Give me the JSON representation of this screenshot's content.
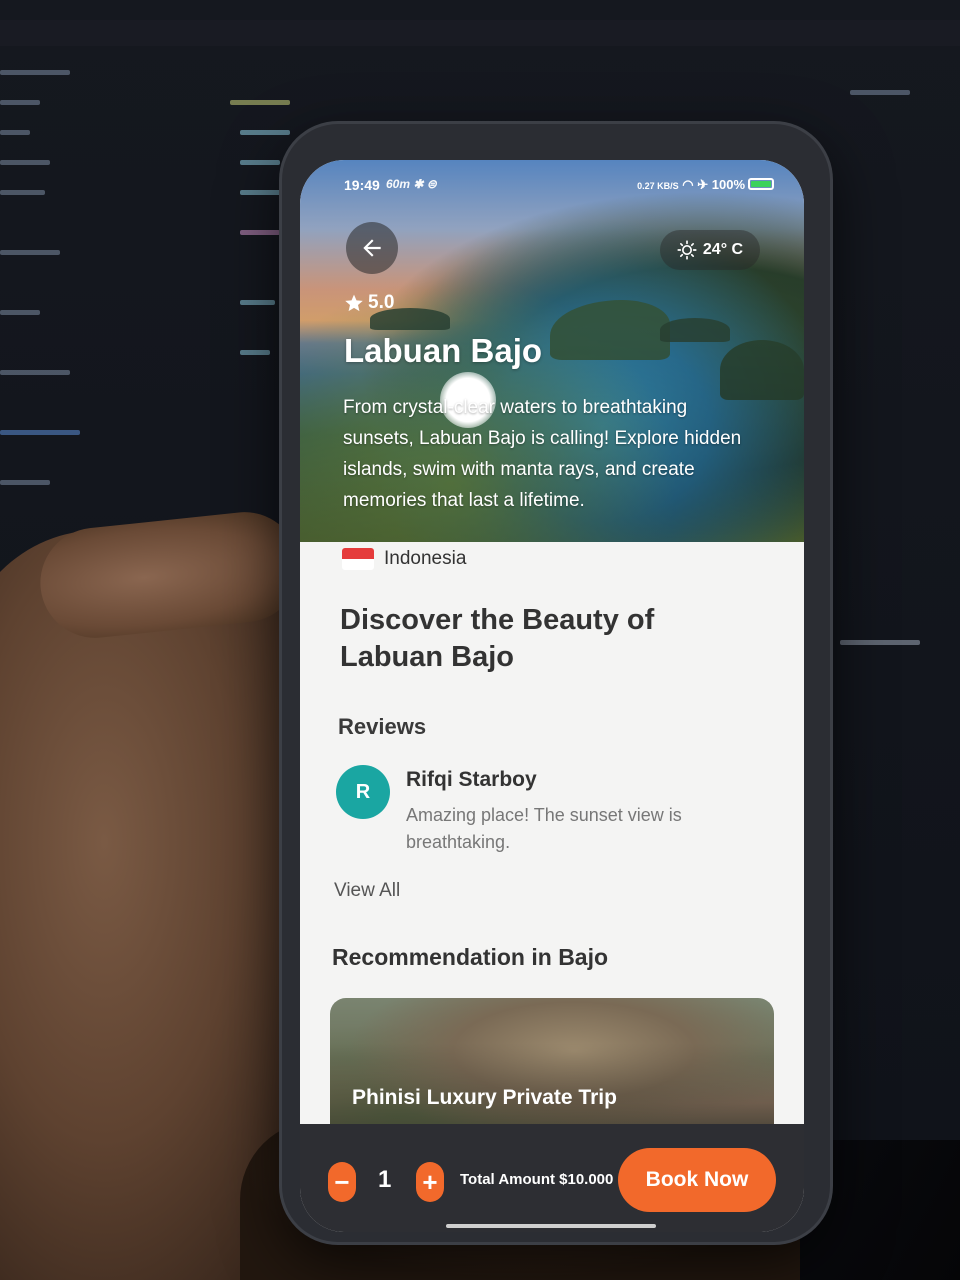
{
  "status_bar": {
    "time": "19:49",
    "left_icons": "60m ✱ ⊜",
    "net_speed": "0.27 KB/S",
    "battery": "100%"
  },
  "hero": {
    "rating": "5.0",
    "title": "Labuan Bajo",
    "description": "From crystal-clear waters to breathtaking sunsets, Labuan Bajo is calling! Explore hidden islands, swim with manta rays, and create memories that last a lifetime.",
    "weather": "24° C"
  },
  "location": {
    "country": "Indonesia"
  },
  "main": {
    "section_title": "Discover the Beauty of Labuan Bajo",
    "reviews_label": "Reviews",
    "review": {
      "avatar_initial": "R",
      "name": "Rifqi Starboy",
      "text": "Amazing place! The sunset view is breathtaking."
    },
    "view_all": "View All",
    "recommendation_title": "Recommendation in Bajo",
    "recommendation": {
      "name": "Phinisi Luxury Private Trip"
    }
  },
  "booking": {
    "quantity": "1",
    "minus": "−",
    "plus": "+",
    "total": "Total Amount $10.000",
    "book_label": "Book Now"
  },
  "colors": {
    "accent": "#f2692b",
    "avatar": "#1aa6a2",
    "bottom_bar": "#2d2e33"
  },
  "icons": [
    "back-arrow-icon",
    "sun-icon",
    "star-icon",
    "indonesia-flag-icon",
    "minus-icon",
    "plus-icon",
    "battery-icon",
    "wifi-icon",
    "airplane-icon"
  ]
}
